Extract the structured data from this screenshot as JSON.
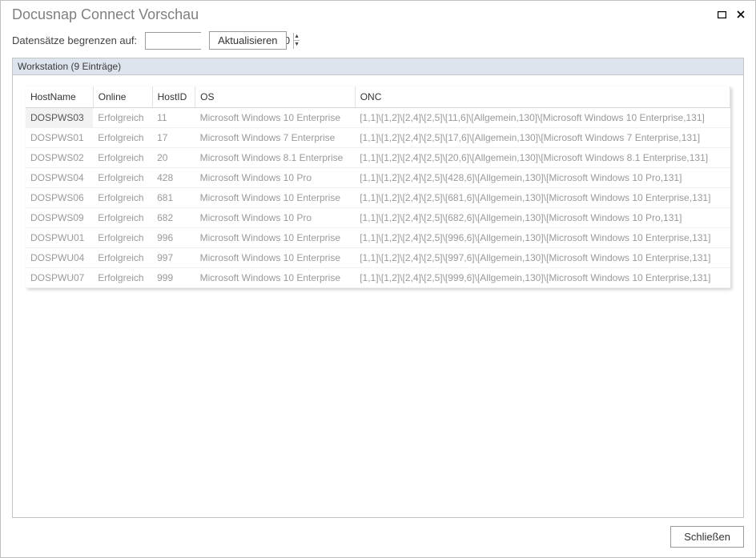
{
  "window": {
    "title": "Docusnap Connect Vorschau"
  },
  "toolbar": {
    "limit_label": "Datensätze begrenzen auf:",
    "limit_value": "10",
    "refresh_label": "Aktualisieren"
  },
  "group": {
    "label": "Workstation (9 Einträge)"
  },
  "columns": {
    "hostname": "HostName",
    "online": "Online",
    "hostid": "HostID",
    "os": "OS",
    "onc": "ONC"
  },
  "rows": [
    {
      "hostname": "DOSPWS03",
      "online": "Erfolgreich",
      "hostid": "11",
      "os": "Microsoft Windows 10 Enterprise",
      "onc": "[1,1]\\[1,2]\\[2,4]\\[2,5]\\[11,6]\\[Allgemein,130]\\[Microsoft Windows 10 Enterprise,131]"
    },
    {
      "hostname": "DOSPWS01",
      "online": "Erfolgreich",
      "hostid": "17",
      "os": "Microsoft Windows 7 Enterprise",
      "onc": "[1,1]\\[1,2]\\[2,4]\\[2,5]\\[17,6]\\[Allgemein,130]\\[Microsoft Windows 7 Enterprise,131]"
    },
    {
      "hostname": "DOSPWS02",
      "online": "Erfolgreich",
      "hostid": "20",
      "os": "Microsoft Windows 8.1 Enterprise",
      "onc": "[1,1]\\[1,2]\\[2,4]\\[2,5]\\[20,6]\\[Allgemein,130]\\[Microsoft Windows 8.1 Enterprise,131]"
    },
    {
      "hostname": "DOSPWS04",
      "online": "Erfolgreich",
      "hostid": "428",
      "os": "Microsoft Windows 10 Pro",
      "onc": "[1,1]\\[1,2]\\[2,4]\\[2,5]\\[428,6]\\[Allgemein,130]\\[Microsoft Windows 10 Pro,131]"
    },
    {
      "hostname": "DOSPWS06",
      "online": "Erfolgreich",
      "hostid": "681",
      "os": "Microsoft Windows 10 Enterprise",
      "onc": "[1,1]\\[1,2]\\[2,4]\\[2,5]\\[681,6]\\[Allgemein,130]\\[Microsoft Windows 10 Enterprise,131]"
    },
    {
      "hostname": "DOSPWS09",
      "online": "Erfolgreich",
      "hostid": "682",
      "os": "Microsoft Windows 10 Pro",
      "onc": "[1,1]\\[1,2]\\[2,4]\\[2,5]\\[682,6]\\[Allgemein,130]\\[Microsoft Windows 10 Pro,131]"
    },
    {
      "hostname": "DOSPWU01",
      "online": "Erfolgreich",
      "hostid": "996",
      "os": "Microsoft Windows 10 Enterprise",
      "onc": "[1,1]\\[1,2]\\[2,4]\\[2,5]\\[996,6]\\[Allgemein,130]\\[Microsoft Windows 10 Enterprise,131]"
    },
    {
      "hostname": "DOSPWU04",
      "online": "Erfolgreich",
      "hostid": "997",
      "os": "Microsoft Windows 10 Enterprise",
      "onc": "[1,1]\\[1,2]\\[2,4]\\[2,5]\\[997,6]\\[Allgemein,130]\\[Microsoft Windows 10 Enterprise,131]"
    },
    {
      "hostname": "DOSPWU07",
      "online": "Erfolgreich",
      "hostid": "999",
      "os": "Microsoft Windows 10 Enterprise",
      "onc": "[1,1]\\[1,2]\\[2,4]\\[2,5]\\[999,6]\\[Allgemein,130]\\[Microsoft Windows 10 Enterprise,131]"
    }
  ],
  "selected_row_index": 0,
  "footer": {
    "close_label": "Schließen"
  }
}
